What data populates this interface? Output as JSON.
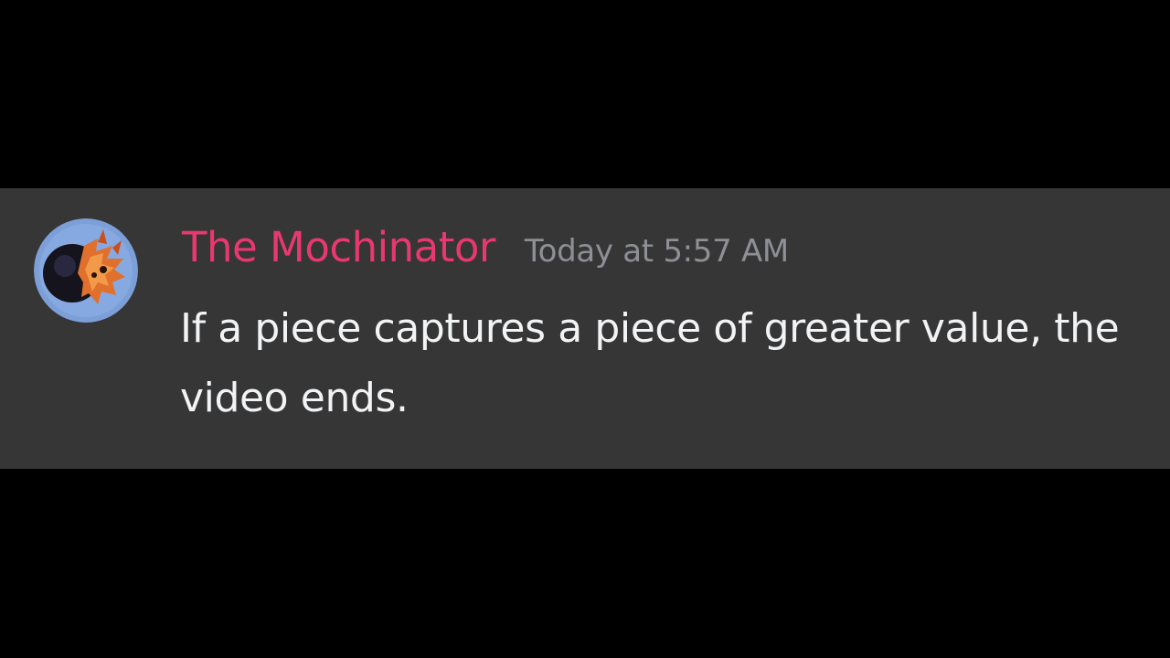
{
  "message": {
    "author": {
      "name": "The Mochinator",
      "name_color": "#e9386f",
      "avatar_icon": "user-avatar-icon"
    },
    "timestamp": "Today at 5:57 AM",
    "content": "If a piece captures a piece of greater value, the video ends."
  },
  "colors": {
    "background": "#000000",
    "card": "#363636",
    "text": "#f2f3f5",
    "timestamp": "#8e9095"
  }
}
